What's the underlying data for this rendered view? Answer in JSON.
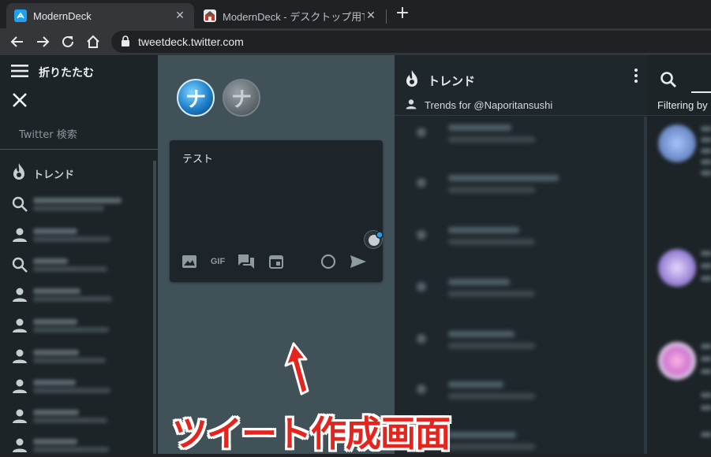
{
  "browser": {
    "tabs": [
      {
        "title": "ModernDeck",
        "active": true,
        "favicon": "moderndeck-favicon",
        "favicon_color": "#1da1f2"
      },
      {
        "title": "ModernDeck - デスクトップ用Twitte",
        "active": false,
        "favicon": "site-favicon",
        "favicon_color": "#e8e8e8"
      }
    ],
    "new_tab": "+",
    "url": "tweetdeck.twitter.com"
  },
  "leftnav": {
    "collapse_label": "折りたたむ",
    "search_placeholder": "Twitter 検索",
    "trend_label": "トレンド",
    "items": [
      {
        "icon": "search-icon"
      },
      {
        "icon": "user-icon"
      },
      {
        "icon": "search-icon"
      },
      {
        "icon": "user-icon"
      },
      {
        "icon": "user-icon"
      },
      {
        "icon": "user-icon"
      },
      {
        "icon": "user-icon"
      },
      {
        "icon": "user-icon"
      },
      {
        "icon": "user-icon"
      }
    ]
  },
  "compose": {
    "accounts": [
      "ナ",
      "ナ"
    ],
    "text": "テスト",
    "tools": [
      "image-icon",
      "gif-icon",
      "poll-icon",
      "schedule-icon",
      "char-count-ring-icon",
      "send-icon"
    ],
    "gif_label": "GIF"
  },
  "trends": {
    "title": "トレンド",
    "subtitle": "Trends for @Naporitansushi",
    "row_count": 10
  },
  "search": {
    "filter_label": "Filtering by"
  },
  "annotation": {
    "caption": "ツイート作成画面",
    "color": "#e4251d"
  },
  "colors": {
    "chrome_dark": "#202124",
    "chrome_toolbar": "#35363a",
    "nav_bg": "#1c2428",
    "compose_bg": "#415158",
    "trend_bg": "#1e272c"
  }
}
